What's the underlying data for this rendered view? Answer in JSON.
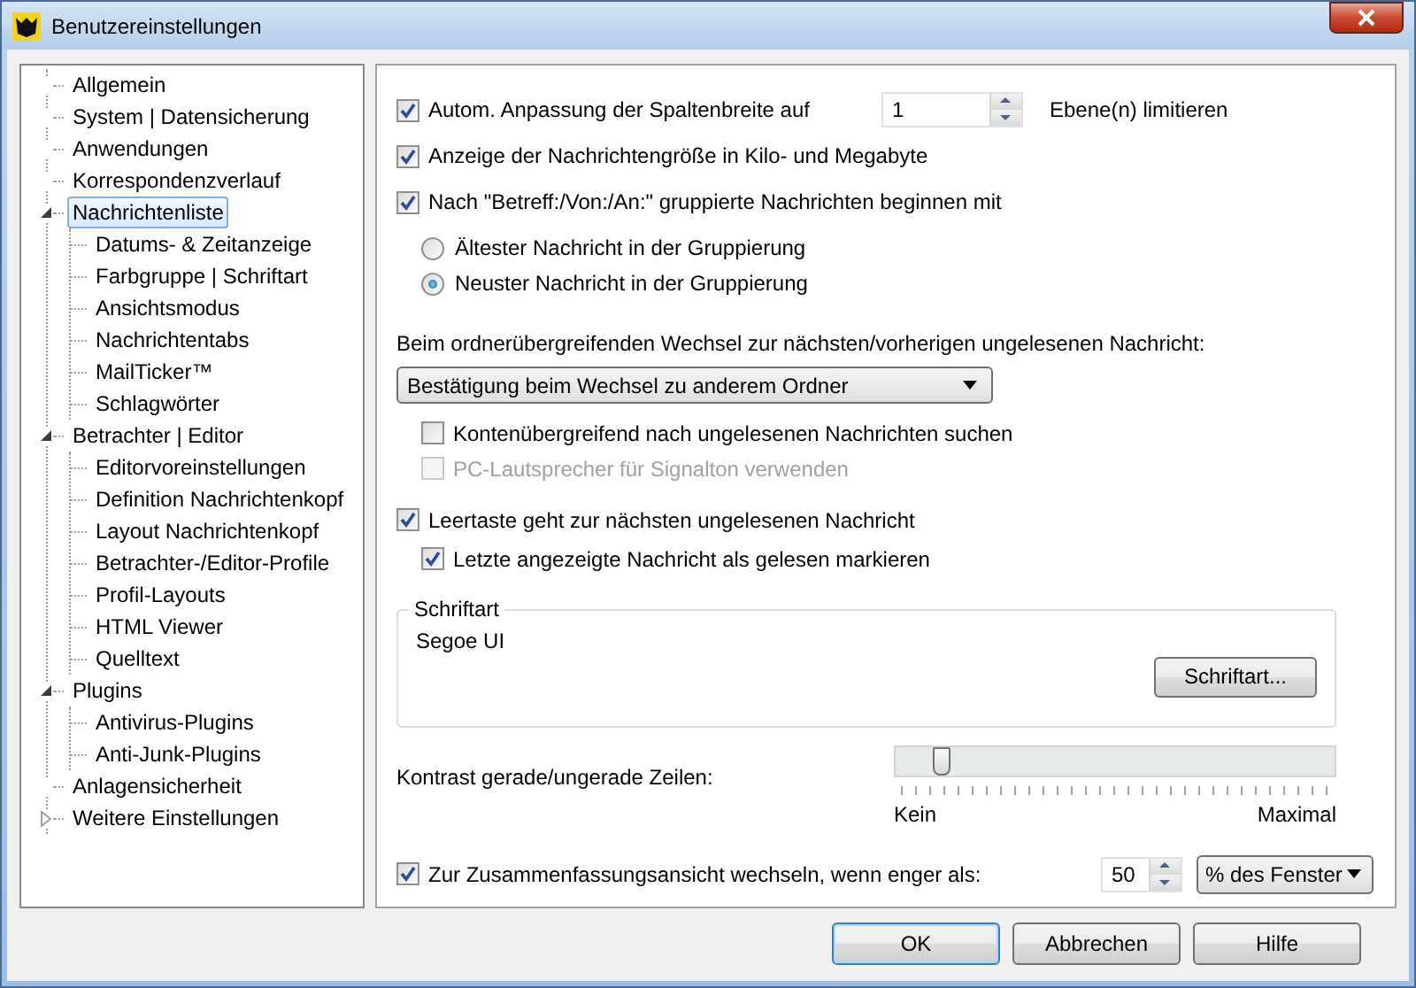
{
  "window": {
    "title": "Benutzereinstellungen"
  },
  "tree": [
    {
      "label": "Allgemein",
      "selected": false
    },
    {
      "label": "System | Datensicherung",
      "selected": false
    },
    {
      "label": "Anwendungen",
      "selected": false
    },
    {
      "label": "Korrespondenzverlauf",
      "selected": false
    },
    {
      "label": "Nachrichtenliste",
      "selected": true,
      "expanded": true,
      "children": [
        {
          "label": "Datums- & Zeitanzeige",
          "selected": false
        },
        {
          "label": "Farbgruppe | Schriftart",
          "selected": false
        },
        {
          "label": "Ansichtsmodus",
          "selected": false
        },
        {
          "label": "Nachrichtentabs",
          "selected": false
        },
        {
          "label": "MailTicker™",
          "selected": false
        },
        {
          "label": "Schlagwörter",
          "selected": false
        }
      ]
    },
    {
      "label": "Betrachter | Editor",
      "selected": false,
      "expanded": true,
      "children": [
        {
          "label": "Editorvoreinstellungen",
          "selected": false
        },
        {
          "label": "Definition Nachrichtenkopf",
          "selected": false
        },
        {
          "label": "Layout Nachrichtenkopf",
          "selected": false
        },
        {
          "label": "Betrachter-/Editor-Profile",
          "selected": false
        },
        {
          "label": "Profil-Layouts",
          "selected": false
        },
        {
          "label": "HTML Viewer",
          "selected": false
        },
        {
          "label": "Quelltext",
          "selected": false
        }
      ]
    },
    {
      "label": "Plugins",
      "selected": false,
      "expanded": true,
      "children": [
        {
          "label": "Antivirus-Plugins",
          "selected": false
        },
        {
          "label": "Anti-Junk-Plugins",
          "selected": false
        }
      ]
    },
    {
      "label": "Anlagensicherheit",
      "selected": false
    },
    {
      "label": "Weitere Einstellungen",
      "selected": false,
      "expanded": false
    }
  ],
  "column_width": {
    "label": "Autom. Anpassung der Spaltenbreite auf",
    "checked": true,
    "value": "1",
    "suffix": "Ebene(n) limitieren"
  },
  "size_display": {
    "label": "Anzeige der Nachrichtengröße in Kilo- und Megabyte",
    "checked": true
  },
  "grouping": {
    "label": "Nach \"Betreff:/Von:/An:\" gruppierte Nachrichten beginnen mit",
    "checked": true,
    "options": [
      {
        "label": "Ältester Nachricht in der Gruppierung",
        "selected": false
      },
      {
        "label": "Neuster Nachricht in der Gruppierung",
        "selected": true
      }
    ]
  },
  "unread_switch": {
    "label": "Beim ordnerübergreifenden Wechsel zur nächsten/vorherigen ungelesenen Nachricht:",
    "dropdown": "Bestätigung beim Wechsel zu anderem Ordner",
    "options": [
      {
        "label": "Kontenübergreifend nach ungelesenen Nachrichten suchen",
        "checked": false,
        "disabled": false
      },
      {
        "label": "PC-Lautsprecher für Signalton verwenden",
        "checked": false,
        "disabled": true
      }
    ]
  },
  "space_key": {
    "label": "Leertaste geht zur nächsten ungelesenen Nachricht",
    "checked": true,
    "sub": {
      "label": "Letzte angezeigte Nachricht als gelesen markieren",
      "checked": true
    }
  },
  "font_group": {
    "title": "Schriftart",
    "font": "Segoe UI",
    "button": "Schriftart..."
  },
  "contrast": {
    "label": "Kontrast gerade/ungerade Zeilen:",
    "level": 0.07,
    "min_label": "Kein",
    "max_label": "Maximal"
  },
  "summary": {
    "label": "Zur Zusammenfassungsansicht wechseln, wenn enger als:",
    "checked": true,
    "value": "50",
    "unit": "% des Fenster"
  },
  "buttons": [
    {
      "label": "OK",
      "default": true
    },
    {
      "label": "Abbrechen",
      "default": false
    },
    {
      "label": "Hilfe",
      "default": false
    }
  ]
}
